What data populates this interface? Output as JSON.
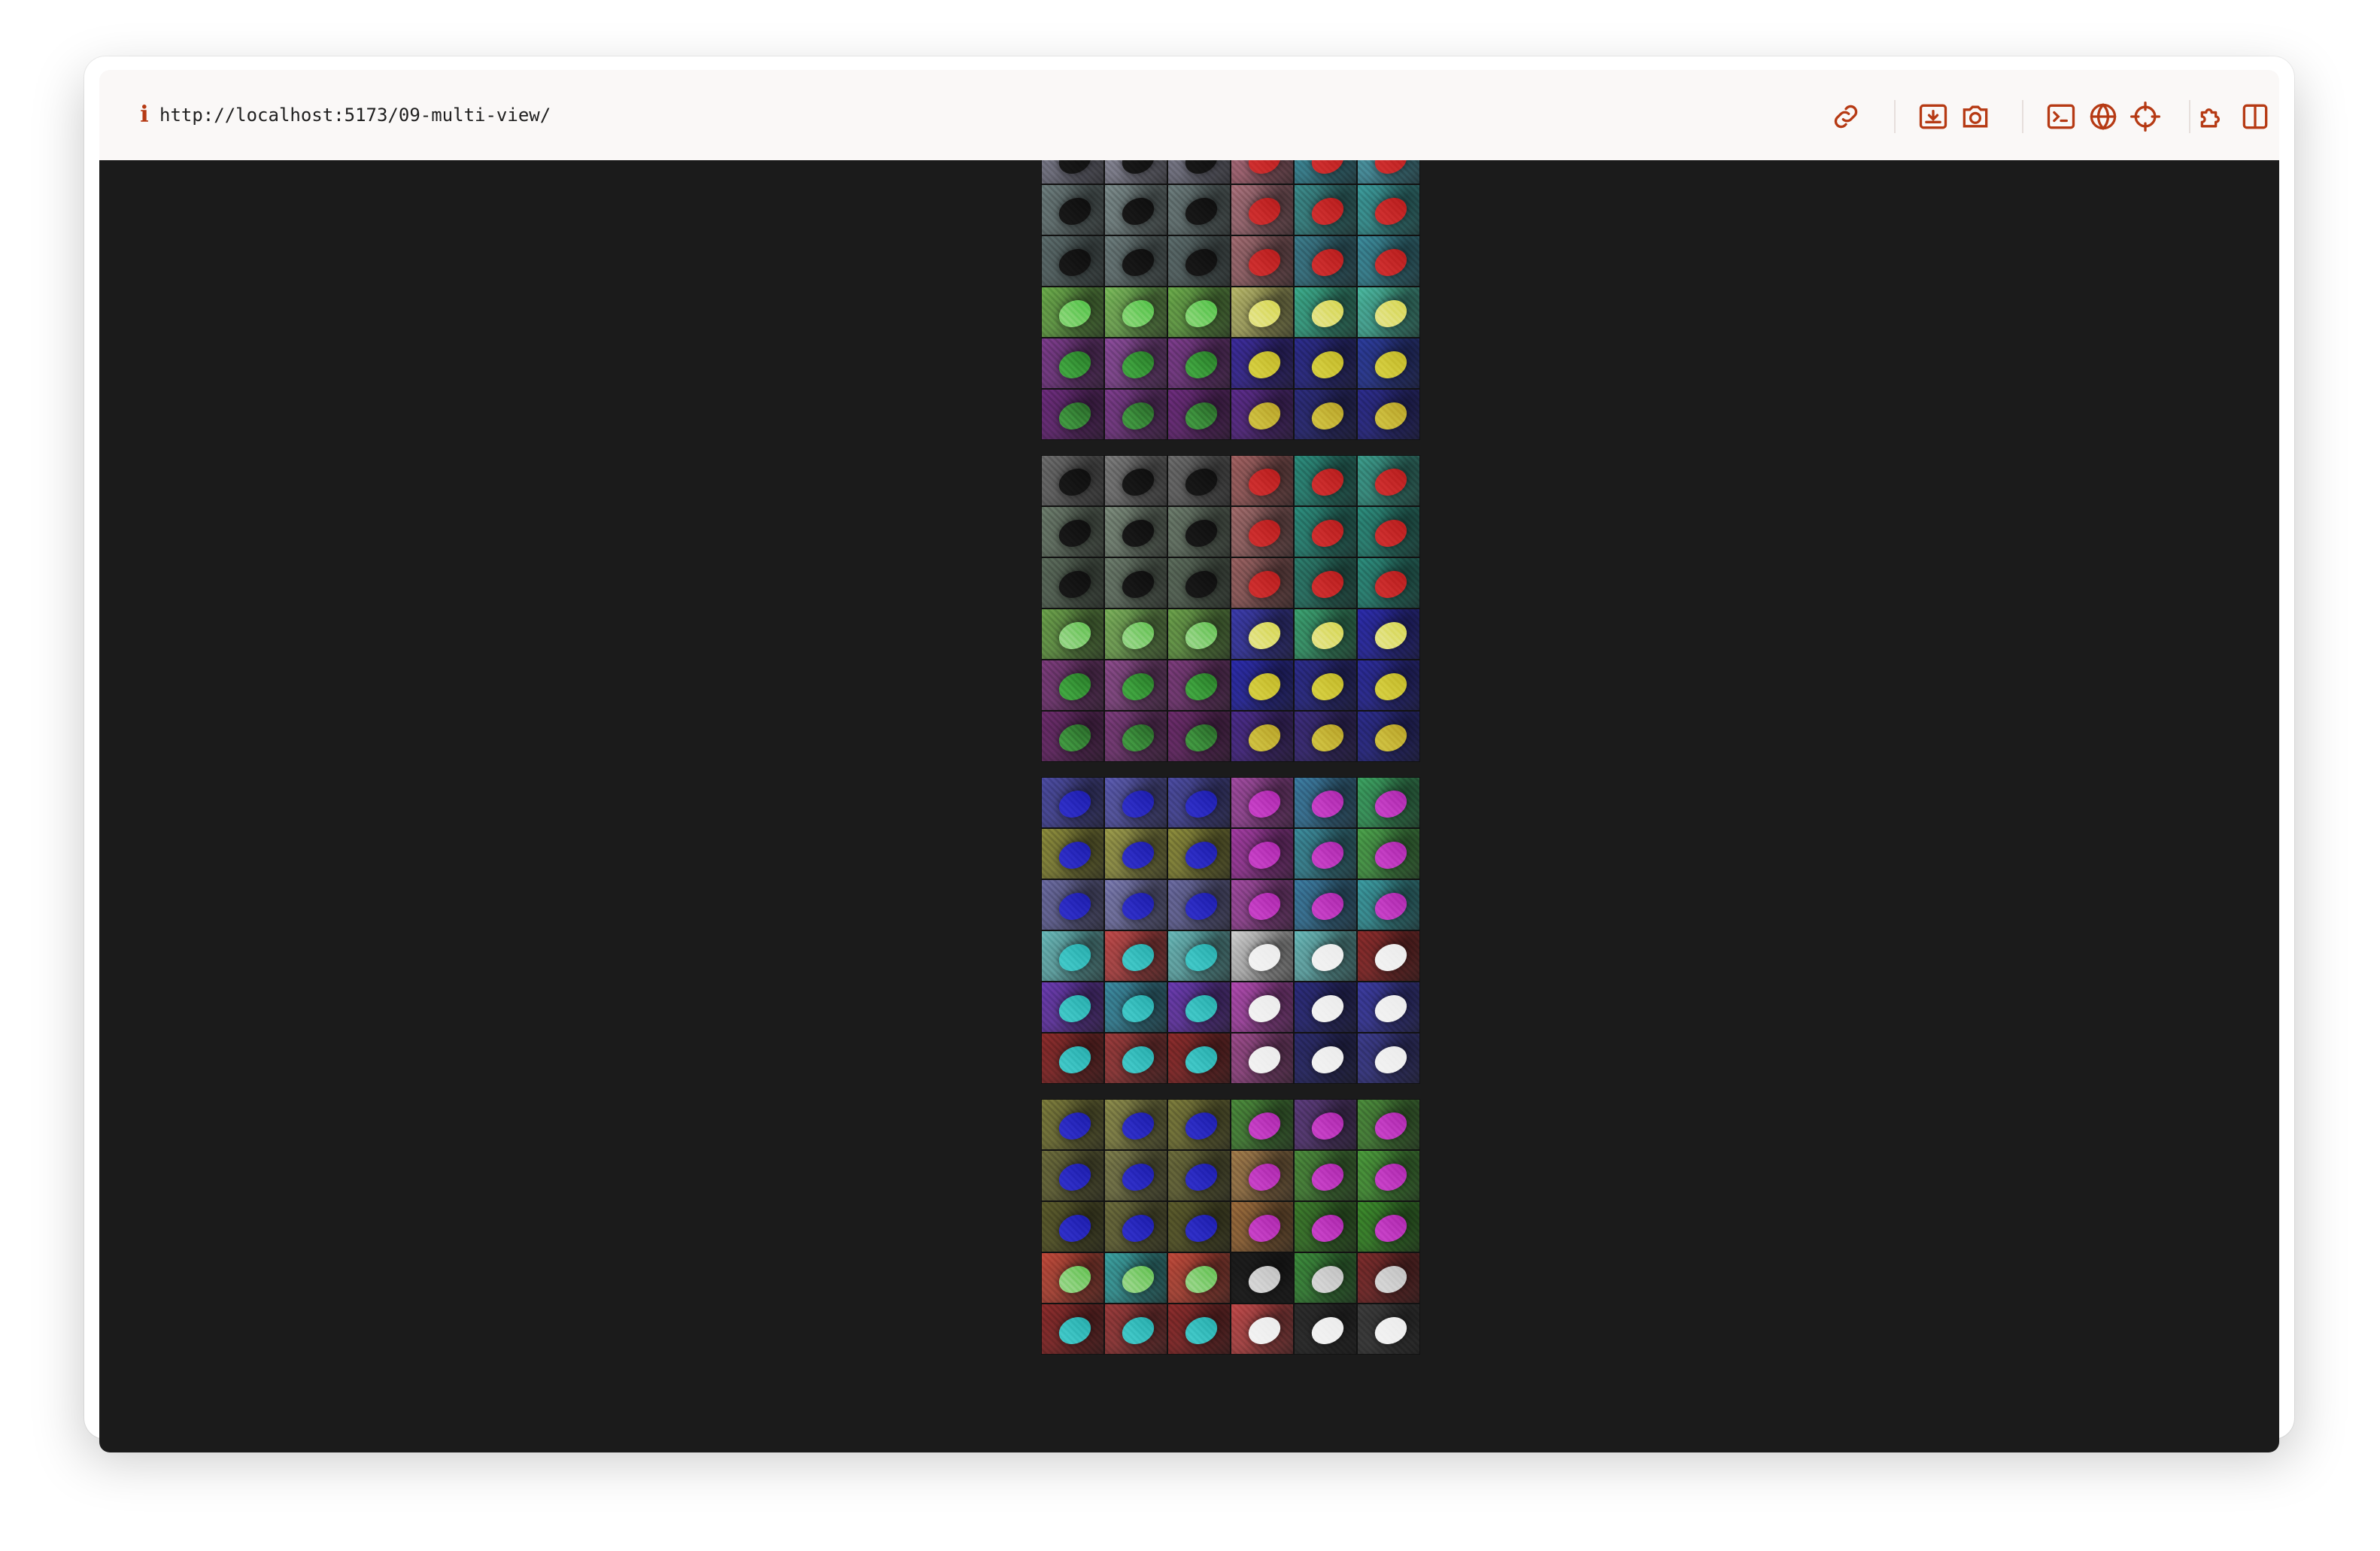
{
  "browser": {
    "url": "http://localhost:5173/09-multi-view/",
    "info_icon": "i",
    "toolbar_icons": [
      "link-icon",
      "download-icon",
      "camera-icon",
      "terminal-icon",
      "globe-icon",
      "crosshair-icon",
      "extension-icon",
      "split-view-icon"
    ]
  },
  "colors": {
    "accent": "#b63a14",
    "viewport_bg": "#1b1b1b"
  },
  "viewer": {
    "columns": 6,
    "blocks": [
      {
        "rows": [
          {
            "bg": [
              "#6a3a76",
              "#7a3e86",
              "#6e3b80",
              "#3a2a88",
              "#2a2a6a",
              "#2a2a8a"
            ],
            "blob": [
              "#3a8a2a",
              "#3a8a2a",
              "#3a8a2a",
              "#c8b83a",
              "#c8b83a",
              "#c8b83a"
            ]
          }
        ]
      },
      {
        "rows": [
          {
            "bg": [
              "#7a7a8a",
              "#8a8a9a",
              "#7a7a8a",
              "#b06a7a",
              "#3a8a9a",
              "#4a9aaa"
            ],
            "blob": [
              "#151515",
              "#151515",
              "#151515",
              "#c82a2a",
              "#c82a2a",
              "#c82a2a"
            ]
          },
          {
            "bg": [
              "#6a7a7a",
              "#7a8a8a",
              "#6a7a7a",
              "#a8707a",
              "#3a8a8a",
              "#3a9a9a"
            ],
            "blob": [
              "#151515",
              "#151515",
              "#151515",
              "#c82a2a",
              "#c82a2a",
              "#c82a2a"
            ]
          },
          {
            "bg": [
              "#5a6a6a",
              "#6a7a7a",
              "#5a6a6a",
              "#a06a70",
              "#3a7a8a",
              "#3a8a9a"
            ],
            "blob": [
              "#151515",
              "#151515",
              "#151515",
              "#c82a2a",
              "#c82a2a",
              "#c82a2a"
            ]
          },
          {
            "bg": [
              "#6aaa4a",
              "#7aba5a",
              "#6aaa4a",
              "#b8b86a",
              "#3aaa8a",
              "#4ab8a0"
            ],
            "blob": [
              "#7ad06a",
              "#7ad06a",
              "#7ad06a",
              "#e0e07a",
              "#e0e07a",
              "#e0e07a"
            ]
          },
          {
            "bg": [
              "#7a3a8a",
              "#8a4a9a",
              "#7a3a8a",
              "#3a2a9a",
              "#2a2a8a",
              "#2a3a9a"
            ],
            "blob": [
              "#3a9a3a",
              "#3a9a3a",
              "#3a9a3a",
              "#d0c83a",
              "#d0c83a",
              "#d0c83a"
            ]
          },
          {
            "bg": [
              "#6a2a7a",
              "#7a3a8a",
              "#6a2a7a",
              "#5a2a8a",
              "#2a2a7a",
              "#2a2a8a"
            ],
            "blob": [
              "#3a8a3a",
              "#3a8a3a",
              "#3a8a3a",
              "#c8b83a",
              "#c8b83a",
              "#c8b83a"
            ]
          }
        ]
      },
      {
        "rows": [
          {
            "bg": [
              "#6a6a6a",
              "#7a7a7a",
              "#6a6a6a",
              "#a06060",
              "#2a8a7a",
              "#3a9a8a"
            ],
            "blob": [
              "#151515",
              "#151515",
              "#151515",
              "#c82a2a",
              "#c82a2a",
              "#c82a2a"
            ]
          },
          {
            "bg": [
              "#6a7a6a",
              "#7a8a7a",
              "#6a7a6a",
              "#a06a6a",
              "#2a8a7a",
              "#2a8a7a"
            ],
            "blob": [
              "#151515",
              "#151515",
              "#151515",
              "#c82a2a",
              "#c82a2a",
              "#c82a2a"
            ]
          },
          {
            "bg": [
              "#5a6a5a",
              "#6a7a6a",
              "#5a6a5a",
              "#986060",
              "#2a7a6a",
              "#2a8a7a"
            ],
            "blob": [
              "#151515",
              "#151515",
              "#151515",
              "#c82a2a",
              "#c82a2a",
              "#c82a2a"
            ]
          },
          {
            "bg": [
              "#6aa04a",
              "#7ab05a",
              "#6aa04a",
              "#3a3aaa",
              "#3aa070",
              "#2a2aaa"
            ],
            "blob": [
              "#8ad07a",
              "#8ad07a",
              "#8ad07a",
              "#e0e07a",
              "#e0e07a",
              "#e0e07a"
            ]
          },
          {
            "bg": [
              "#7a3a7a",
              "#8a4a8a",
              "#7a3a7a",
              "#2a2aaa",
              "#2a2a8a",
              "#2a2a9a"
            ],
            "blob": [
              "#3a9a3a",
              "#3a9a3a",
              "#3a9a3a",
              "#d0c83a",
              "#d0c83a",
              "#d0c83a"
            ]
          },
          {
            "bg": [
              "#6a2a6a",
              "#7a3a7a",
              "#6a2a6a",
              "#4a2a8a",
              "#3a2a7a",
              "#2a2a8a"
            ],
            "blob": [
              "#3a8a3a",
              "#3a8a3a",
              "#3a8a3a",
              "#c8b83a",
              "#c8b83a",
              "#c8b83a"
            ]
          }
        ]
      },
      {
        "rows": [
          {
            "bg": [
              "#4a4aa0",
              "#5a5ab0",
              "#4a4aa0",
              "#a04aa0",
              "#3a7aa0",
              "#3aa060"
            ],
            "blob": [
              "#2a2ac0",
              "#2a2ac0",
              "#2a2ac0",
              "#c03ac0",
              "#c03ac0",
              "#c03ac0"
            ]
          },
          {
            "bg": [
              "#8a8a3a",
              "#9a9a4a",
              "#8a8a3a",
              "#a03aa0",
              "#3a8a9a",
              "#4aa04a"
            ],
            "blob": [
              "#2a2ac0",
              "#2a2ac0",
              "#2a2ac0",
              "#c03ac0",
              "#c03ac0",
              "#c03ac0"
            ]
          },
          {
            "bg": [
              "#6a6aa0",
              "#7a7ab0",
              "#6a6aa0",
              "#a04aa0",
              "#3a7aa0",
              "#3a9aa0"
            ],
            "blob": [
              "#2a2ac0",
              "#2a2ac0",
              "#2a2ac0",
              "#c03ac0",
              "#c03ac0",
              "#c03ac0"
            ]
          },
          {
            "bg": [
              "#6ababa",
              "#c04a4a",
              "#6ababa",
              "#d0d0d0",
              "#6ababa",
              "#8a2a2a"
            ],
            "blob": [
              "#3ac0c0",
              "#3ac0c0",
              "#3ac0c0",
              "#f0f0f0",
              "#f0f0f0",
              "#f0f0f0"
            ]
          },
          {
            "bg": [
              "#6a3ab0",
              "#3a8aa0",
              "#6a3ab0",
              "#b04ab0",
              "#2a2a7a",
              "#3a3aa0"
            ],
            "blob": [
              "#3ac0c0",
              "#3ac0c0",
              "#3ac0c0",
              "#f0f0f0",
              "#f0f0f0",
              "#f0f0f0"
            ]
          },
          {
            "bg": [
              "#8a2a2a",
              "#9a3a3a",
              "#8a2a2a",
              "#9a4a8a",
              "#2a2a6a",
              "#3a3a8a"
            ],
            "blob": [
              "#3ac0c0",
              "#3ac0c0",
              "#3ac0c0",
              "#f0f0f0",
              "#f0f0f0",
              "#f0f0f0"
            ]
          }
        ]
      },
      {
        "rows": [
          {
            "bg": [
              "#7a7a3a",
              "#8a8a4a",
              "#7a7a3a",
              "#4a8a3a",
              "#5a3a7a",
              "#4a8a3a"
            ],
            "blob": [
              "#2a2ac0",
              "#2a2ac0",
              "#2a2ac0",
              "#c03ac0",
              "#c03ac0",
              "#c03ac0"
            ]
          },
          {
            "bg": [
              "#6a6a3a",
              "#7a7a4a",
              "#6a6a3a",
              "#a07a4a",
              "#4a8a3a",
              "#4a9a3a"
            ],
            "blob": [
              "#2a2ac0",
              "#2a2ac0",
              "#2a2ac0",
              "#c03ac0",
              "#c03ac0",
              "#c03ac0"
            ]
          },
          {
            "bg": [
              "#5a5a2a",
              "#6a6a3a",
              "#5a5a2a",
              "#9a6a3a",
              "#3a7a2a",
              "#3a8a2a"
            ],
            "blob": [
              "#2a2ac0",
              "#2a2ac0",
              "#2a2ac0",
              "#c03ac0",
              "#c03ac0",
              "#c03ac0"
            ]
          },
          {
            "bg": [
              "#c04a3a",
              "#3aa0a0",
              "#c04a3a",
              "#1a1a1a",
              "#3a8a3a",
              "#7a2a2a"
            ],
            "blob": [
              "#8ad07a",
              "#8ad07a",
              "#8ad07a",
              "#d0d0d0",
              "#d0d0d0",
              "#d0d0d0"
            ]
          },
          {
            "bg": [
              "#8a2a2a",
              "#9a3a3a",
              "#8a2a2a",
              "#c04a4a",
              "#2a2a2a",
              "#3a3a3a"
            ],
            "blob": [
              "#3ac0c0",
              "#3ac0c0",
              "#3ac0c0",
              "#f0f0f0",
              "#f0f0f0",
              "#f0f0f0"
            ]
          }
        ]
      }
    ]
  }
}
